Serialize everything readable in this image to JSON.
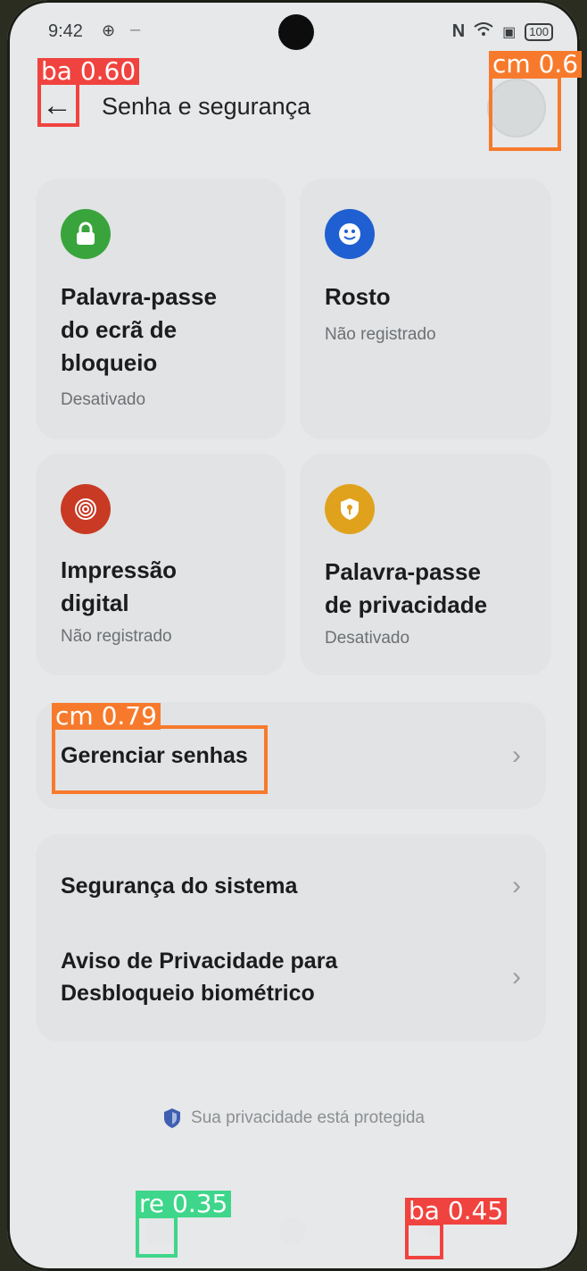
{
  "status_bar": {
    "time": "9:42",
    "left_icon": "location-icon",
    "dash": "–",
    "battery": "100"
  },
  "header": {
    "title": "Senha e segurança",
    "back_icon": "←"
  },
  "cards": [
    {
      "title_lines": [
        "Palavra-passe",
        "do ecrã de",
        "bloqueio"
      ],
      "status": "Desativado",
      "icon": "lock-icon",
      "color": "#3aa43c"
    },
    {
      "title_lines": [
        "Rosto"
      ],
      "status": "Não registrado",
      "icon": "face-icon",
      "color": "#1f5fd1"
    },
    {
      "title_lines": [
        "Impressão",
        "digital"
      ],
      "status": "Não registrado",
      "icon": "fingerprint-icon",
      "color": "#c83a24"
    },
    {
      "title_lines": [
        "Palavra-passe",
        "de privacidade"
      ],
      "status": "Desativado",
      "icon": "privacy-key-icon",
      "color": "#e0a21d"
    }
  ],
  "manage_passwords": {
    "label": "Gerenciar senhas"
  },
  "system_list": {
    "items": [
      {
        "label_lines": [
          "Segurança do sistema"
        ]
      },
      {
        "label_lines": [
          "Aviso de Privacidade para",
          "Desbloqueio biométrico"
        ]
      }
    ]
  },
  "privacy_note": "Sua privacidade está protegida",
  "detections": [
    {
      "label": "ba 0.60",
      "color": "#f0433f"
    },
    {
      "label": "cm 0.6",
      "color": "#f77a2c"
    },
    {
      "label": "cm 0.79",
      "color": "#f77a2c"
    },
    {
      "label": "re 0.35",
      "color": "#3ed68a"
    },
    {
      "label": "ba 0.45",
      "color": "#f0433f"
    }
  ]
}
